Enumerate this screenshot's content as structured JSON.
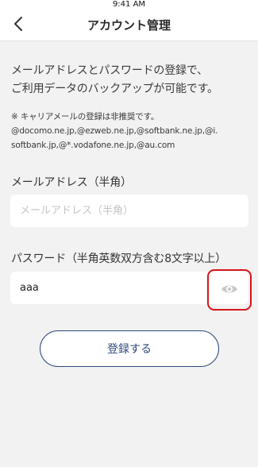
{
  "status_bar": {
    "time": "9:41 AM"
  },
  "nav": {
    "title": "アカウント管理",
    "back_icon": "chevron-left-icon"
  },
  "intro": {
    "line1": "メールアドレスとパスワードの登録で、",
    "line2": "ご利用データのバックアップが可能です。"
  },
  "note": {
    "line1": "※ キャリアメールの登録は非推奨です。",
    "line2": "@docomo.ne.jp,@ezweb.ne.jp,@softbank.ne.jp,@i.",
    "line3": "softbank.jp,@*.vodafone.ne.jp,@au.com"
  },
  "email": {
    "label": "メールアドレス（半角）",
    "placeholder": "メールアドレス（半角）",
    "value": ""
  },
  "password": {
    "label": "パスワード（半角英数双方含む8文字以上）",
    "value": "aaa",
    "toggle_icon": "eye-icon",
    "highlight_color": "#d8141b"
  },
  "register_button": {
    "label": "登録する"
  },
  "colors": {
    "background": "#f2f2f2",
    "accent": "#2e4a7a",
    "field_background": "#ffffff"
  }
}
